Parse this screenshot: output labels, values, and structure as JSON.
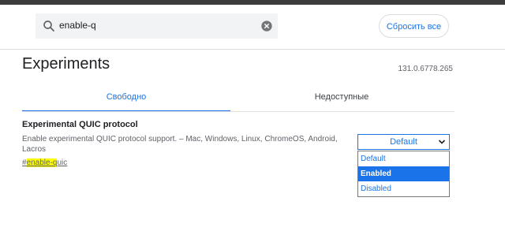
{
  "search": {
    "query": "enable-q"
  },
  "header": {
    "reset_label": "Сбросить все"
  },
  "page": {
    "title": "Experiments",
    "version": "131.0.6778.265"
  },
  "tabs": [
    {
      "label": "Свободно"
    },
    {
      "label": "Недоступные"
    }
  ],
  "experiment": {
    "title": "Experimental QUIC protocol",
    "description": "Enable experimental QUIC protocol support. – Mac, Windows, Linux, ChromeOS, Android, Lacros",
    "link_prefix": "#",
    "link_highlight": "enable-q",
    "link_rest": "uic",
    "select_value": "Default",
    "options": [
      {
        "label": "Default"
      },
      {
        "label": "Enabled"
      },
      {
        "label": "Disabled"
      }
    ],
    "highlighted_option": "Enabled"
  },
  "colors": {
    "accent": "#1a73e8",
    "highlight": "#ffff00",
    "topbar": "#3c3c3c"
  }
}
